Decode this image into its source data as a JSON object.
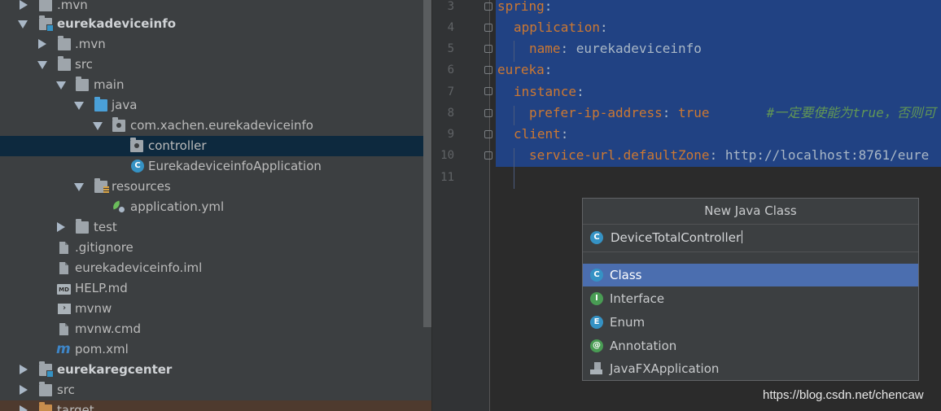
{
  "project_tree": {
    "items": [
      {
        "label": ".mvn",
        "icon": "folder-icon"
      },
      {
        "label": "eurekadeviceinfo",
        "icon": "module-folder-icon"
      },
      {
        "label": ".mvn",
        "icon": "folder-icon"
      },
      {
        "label": "src",
        "icon": "folder-icon"
      },
      {
        "label": "main",
        "icon": "folder-icon"
      },
      {
        "label": "java",
        "icon": "source-folder-icon"
      },
      {
        "label": "com.xachen.eurekadeviceinfo",
        "icon": "package-icon"
      },
      {
        "label": "controller",
        "icon": "package-icon"
      },
      {
        "label": "EurekadeviceinfoApplication",
        "icon": "spring-class-icon"
      },
      {
        "label": "resources",
        "icon": "resources-folder-icon"
      },
      {
        "label": "application.yml",
        "icon": "spring-yml-icon"
      },
      {
        "label": "test",
        "icon": "folder-icon"
      },
      {
        "label": ".gitignore",
        "icon": "file-icon"
      },
      {
        "label": "eurekadeviceinfo.iml",
        "icon": "file-icon"
      },
      {
        "label": "HELP.md",
        "icon": "markdown-icon"
      },
      {
        "label": "mvnw",
        "icon": "terminal-file-icon"
      },
      {
        "label": "mvnw.cmd",
        "icon": "file-icon"
      },
      {
        "label": "pom.xml",
        "icon": "maven-icon"
      },
      {
        "label": "eurekaregcenter",
        "icon": "module-folder-icon"
      },
      {
        "label": "src",
        "icon": "folder-icon"
      },
      {
        "label": "target",
        "icon": "folder-icon"
      }
    ],
    "selected": "controller"
  },
  "editor": {
    "line_numbers": [
      "3",
      "4",
      "5",
      "6",
      "7",
      "8",
      "9",
      "10",
      "11"
    ],
    "lines": [
      {
        "key": "spring",
        "sep": ":",
        "value": "",
        "comment": ""
      },
      {
        "key": "application",
        "sep": ":",
        "value": "",
        "comment": ""
      },
      {
        "key": "name",
        "sep": ": ",
        "value": "eurekadeviceinfo",
        "comment": ""
      },
      {
        "key": "eureka",
        "sep": ":",
        "value": "",
        "comment": ""
      },
      {
        "key": "instance",
        "sep": ":",
        "value": "",
        "comment": ""
      },
      {
        "key": "prefer-ip-address",
        "sep": ": ",
        "value": "true",
        "comment": "#一定要使能为true，否则可"
      },
      {
        "key": "client",
        "sep": ":",
        "value": "",
        "comment": ""
      },
      {
        "key": "service-url.defaultZone",
        "sep": ": ",
        "value": "http://localhost:8761/eure",
        "comment": ""
      },
      {
        "key": "",
        "sep": "",
        "value": "",
        "comment": ""
      }
    ]
  },
  "new_class_popup": {
    "title": "New Java Class",
    "input_value": "DeviceTotalController",
    "options": [
      {
        "label": "Class",
        "icon": "class-icon",
        "letter": "C",
        "color": "#3592c4"
      },
      {
        "label": "Interface",
        "icon": "interface-icon",
        "letter": "I",
        "color": "#499c54"
      },
      {
        "label": "Enum",
        "icon": "enum-icon",
        "letter": "E",
        "color": "#3592c4"
      },
      {
        "label": "Annotation",
        "icon": "annotation-icon",
        "letter": "@",
        "color": "#499c54"
      },
      {
        "label": "JavaFXApplication",
        "icon": "javafx-icon",
        "letter": "",
        "color": "#9ea5ab"
      }
    ],
    "selected_option": "Class"
  },
  "watermark": "https://blog.csdn.net/chencaw",
  "colors": {
    "tree_bg": "#3c3f41",
    "editor_bg": "#2b2b2b",
    "selection": "#214283",
    "popup_active": "#4b6eaf",
    "yaml_key": "#cc7832",
    "comment": "#629755"
  }
}
